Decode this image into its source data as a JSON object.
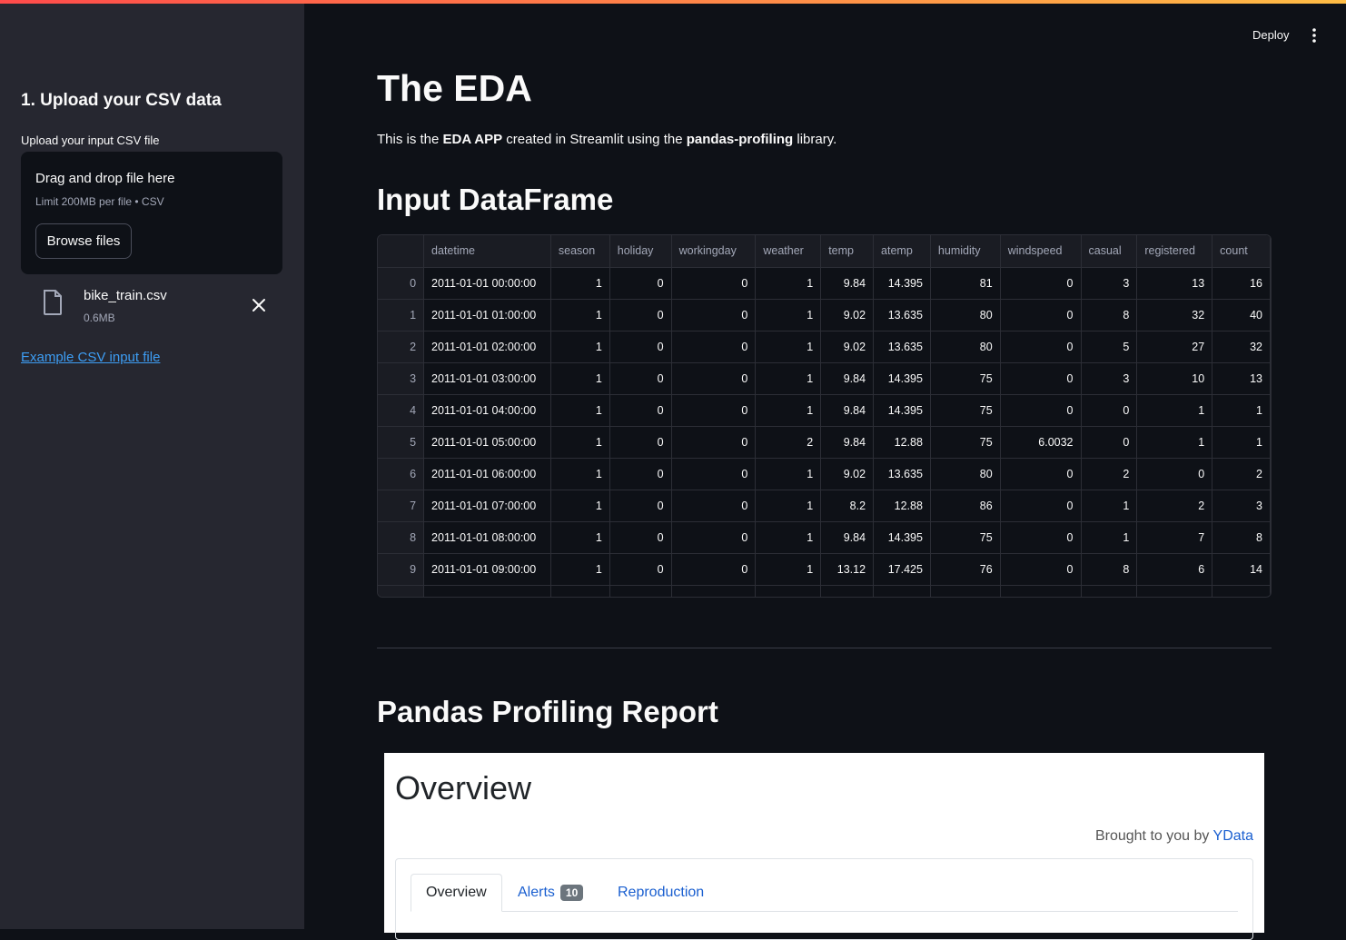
{
  "sidebar": {
    "title": "1. Upload your CSV data",
    "upload_label": "Upload your input CSV file",
    "dropzone_title": "Drag and drop file here",
    "dropzone_limit": "Limit 200MB per file • CSV",
    "browse_label": "Browse files",
    "file_name": "bike_train.csv",
    "file_size": "0.6MB",
    "example_link": "Example CSV input file"
  },
  "header": {
    "deploy_label": "Deploy"
  },
  "main": {
    "title": "The EDA",
    "intro": {
      "pre": "This is the ",
      "b1": "EDA APP",
      "mid": " created in Streamlit using the ",
      "b2": "pandas-profiling",
      "post": " library."
    },
    "df_title": "Input DataFrame",
    "profile_title": "Pandas Profiling Report"
  },
  "dataframe": {
    "columns": [
      "",
      "datetime",
      "season",
      "holiday",
      "workingday",
      "weather",
      "temp",
      "atemp",
      "humidity",
      "windspeed",
      "casual",
      "registered",
      "count"
    ],
    "rows": [
      [
        "0",
        "2011-01-01 00:00:00",
        "1",
        "0",
        "0",
        "1",
        "9.84",
        "14.395",
        "81",
        "0",
        "3",
        "13",
        "16"
      ],
      [
        "1",
        "2011-01-01 01:00:00",
        "1",
        "0",
        "0",
        "1",
        "9.02",
        "13.635",
        "80",
        "0",
        "8",
        "32",
        "40"
      ],
      [
        "2",
        "2011-01-01 02:00:00",
        "1",
        "0",
        "0",
        "1",
        "9.02",
        "13.635",
        "80",
        "0",
        "5",
        "27",
        "32"
      ],
      [
        "3",
        "2011-01-01 03:00:00",
        "1",
        "0",
        "0",
        "1",
        "9.84",
        "14.395",
        "75",
        "0",
        "3",
        "10",
        "13"
      ],
      [
        "4",
        "2011-01-01 04:00:00",
        "1",
        "0",
        "0",
        "1",
        "9.84",
        "14.395",
        "75",
        "0",
        "0",
        "1",
        "1"
      ],
      [
        "5",
        "2011-01-01 05:00:00",
        "1",
        "0",
        "0",
        "2",
        "9.84",
        "12.88",
        "75",
        "6.0032",
        "0",
        "1",
        "1"
      ],
      [
        "6",
        "2011-01-01 06:00:00",
        "1",
        "0",
        "0",
        "1",
        "9.02",
        "13.635",
        "80",
        "0",
        "2",
        "0",
        "2"
      ],
      [
        "7",
        "2011-01-01 07:00:00",
        "1",
        "0",
        "0",
        "1",
        "8.2",
        "12.88",
        "86",
        "0",
        "1",
        "2",
        "3"
      ],
      [
        "8",
        "2011-01-01 08:00:00",
        "1",
        "0",
        "0",
        "1",
        "9.84",
        "14.395",
        "75",
        "0",
        "1",
        "7",
        "8"
      ],
      [
        "9",
        "2011-01-01 09:00:00",
        "1",
        "0",
        "0",
        "1",
        "13.12",
        "17.425",
        "76",
        "0",
        "8",
        "6",
        "14"
      ]
    ]
  },
  "report": {
    "overview_title": "Overview",
    "brought_text": "Brought to you by ",
    "brought_link": "YData",
    "tabs": [
      {
        "label": "Overview"
      },
      {
        "label": "Alerts",
        "badge": "10"
      },
      {
        "label": "Reproduction"
      }
    ]
  },
  "colors": {
    "accent": "#ff4b4b",
    "link": "#3d9df3",
    "sidebar_bg": "#262730",
    "main_bg": "#0e1117"
  },
  "icons": {
    "file": "file-icon",
    "close": "close-icon",
    "menu": "kebab-menu-icon"
  }
}
